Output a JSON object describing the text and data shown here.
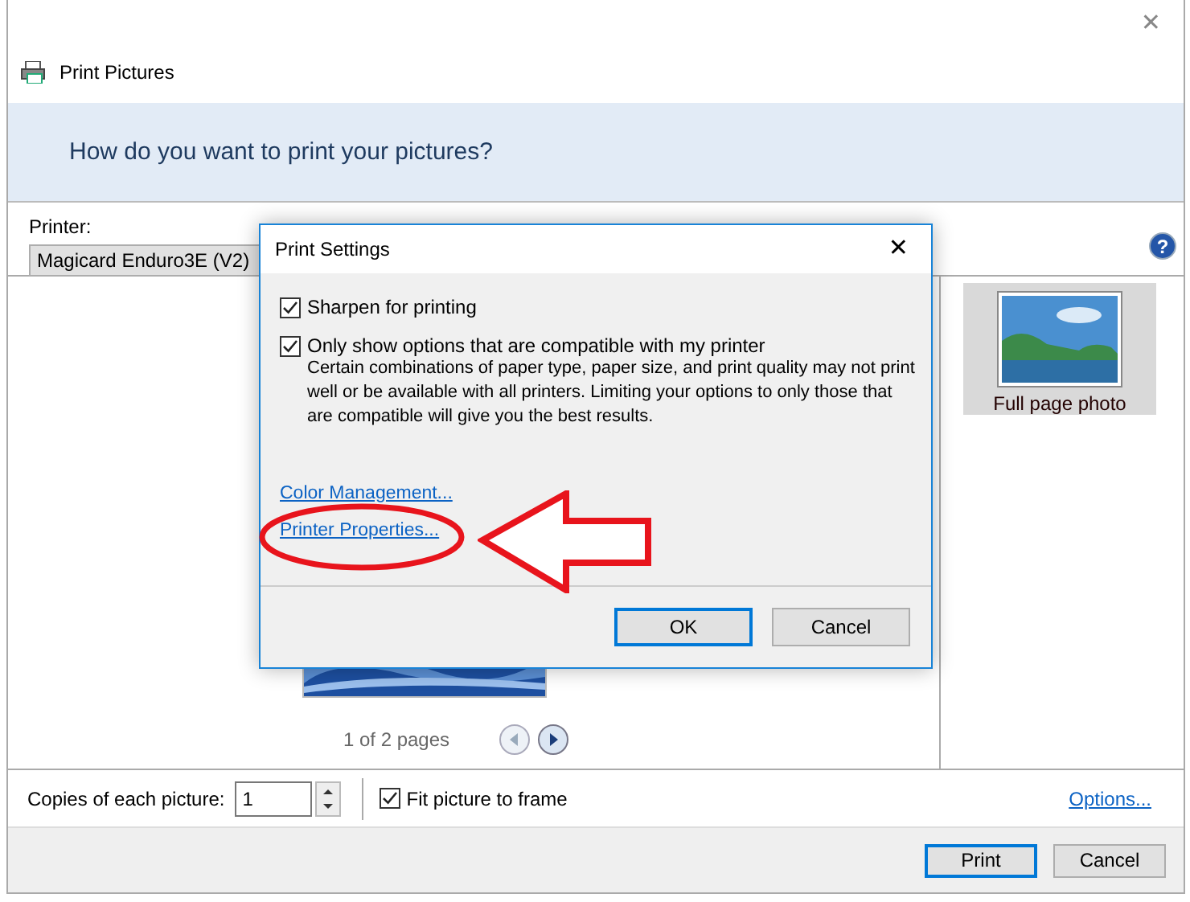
{
  "window": {
    "title": "Print Pictures",
    "close": "✕"
  },
  "header": {
    "question": "How do you want to print your pictures?"
  },
  "help": "?",
  "printer": {
    "label": "Printer:",
    "value": "Magicard Enduro3E (V2)"
  },
  "preview": {
    "pager": "1 of 2 pages",
    "prev_disabled": true
  },
  "layouts": [
    {
      "label": "Full page photo",
      "selected": true
    }
  ],
  "bottom": {
    "copies_label": "Copies of each picture:",
    "copies": "1",
    "fit": {
      "label": "Fit picture to frame",
      "checked": true
    },
    "options_link": "Options..."
  },
  "buttons": [
    {
      "label": "Print",
      "default": true
    },
    {
      "label": "Cancel",
      "default": false
    }
  ],
  "dialog": {
    "title": "Print Settings",
    "close": "✕",
    "options": [
      {
        "label": "Sharpen for printing",
        "checked": true
      },
      {
        "label": "Only show options that are compatible with my printer",
        "checked": true,
        "description": "Certain combinations of paper type, paper size, and print quality may not print well or be available with all printers.  Limiting your options to only those that are compatible will give you the best results."
      }
    ],
    "links": [
      "Color Management...",
      "Printer Properties..."
    ],
    "buttons": [
      {
        "label": "OK",
        "default": true
      },
      {
        "label": "Cancel",
        "default": false
      }
    ]
  }
}
